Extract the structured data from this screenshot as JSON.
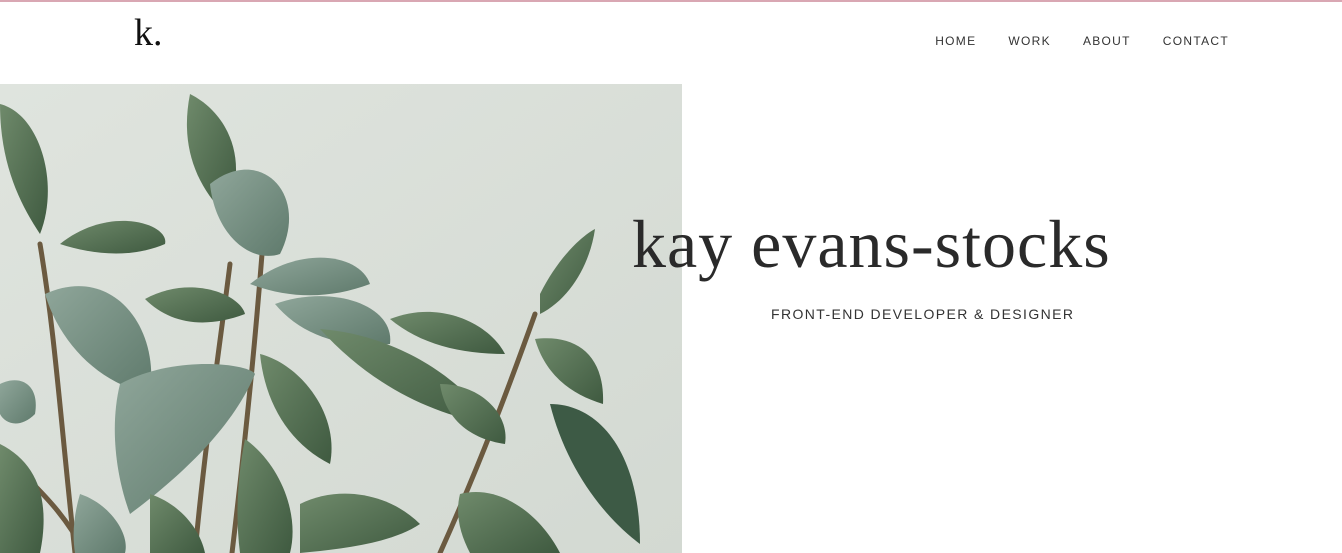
{
  "header": {
    "logo": "k.",
    "nav": [
      {
        "label": "HOME"
      },
      {
        "label": "WORK"
      },
      {
        "label": "ABOUT"
      },
      {
        "label": "CONTACT"
      }
    ]
  },
  "hero": {
    "image_description_icon": "plant-photo",
    "title": "kay evans-stocks",
    "subtitle": "FRONT-END DEVELOPER & DESIGNER"
  },
  "colors": {
    "accent_line": "#d9a7b3",
    "photo_background": "#dde2dc",
    "leaf": "#5f7a5c",
    "text": "#2a2a2a"
  }
}
